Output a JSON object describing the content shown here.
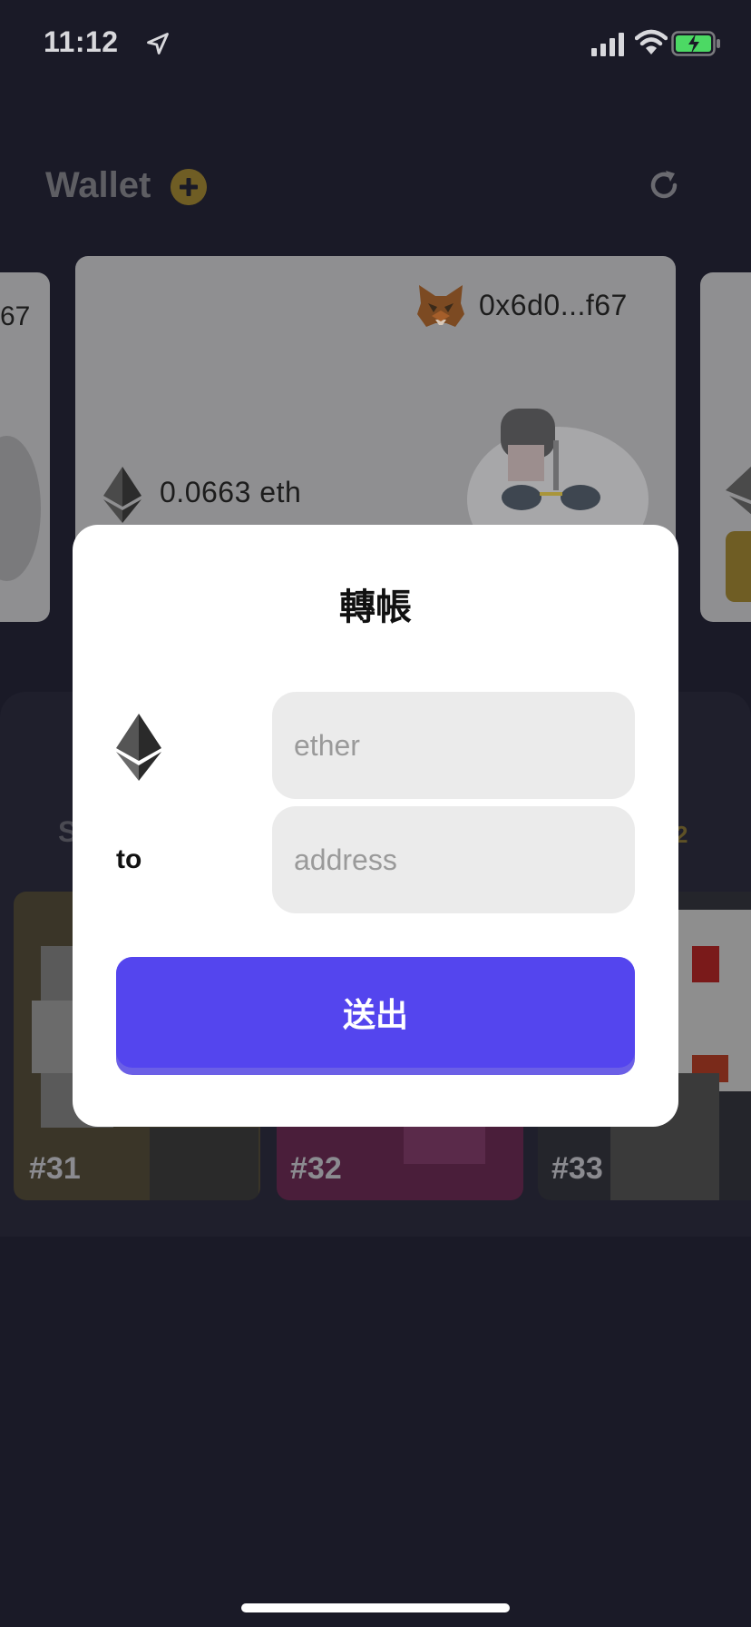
{
  "status_bar": {
    "time": "11:12"
  },
  "header": {
    "title": "Wallet"
  },
  "cards": {
    "left_address_fragment": "67",
    "main_address": "0x6d0...f67",
    "main_balance": "0.0663 eth"
  },
  "panel": {
    "section_letter": "S",
    "section_number": "2",
    "nfts": [
      {
        "label": "#31"
      },
      {
        "label": "#32"
      },
      {
        "label": "#33"
      }
    ]
  },
  "modal": {
    "title": "轉帳",
    "to_label": "to",
    "ether_placeholder": "ether",
    "address_placeholder": "address",
    "send_label": "送出"
  },
  "colors": {
    "background": "#1a1a27",
    "accent_purple": "#5445ee",
    "gold": "#6f5d24"
  }
}
